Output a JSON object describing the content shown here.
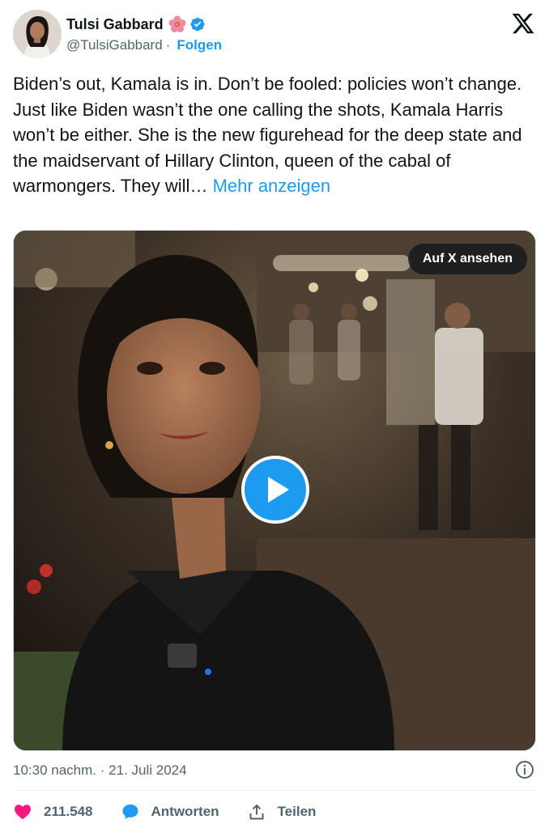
{
  "author": {
    "name": "Tulsi Gabbard",
    "handle": "@TulsiGabbard",
    "separator": "·",
    "follow_label": "Folgen",
    "emoji_icon": "hibiscus-icon",
    "verified_icon": "verified-badge-icon"
  },
  "tweet": {
    "text": "Biden’s out, Kamala is in. Don’t be fooled: policies won’t change.  Just like Biden wasn’t the one calling the shots, Kamala Harris won’t be either. She is the new figurehead for the deep state and the maidservant of Hillary Clinton, queen of the cabal of warmongers. They will…",
    "more_label": "Mehr anzeigen"
  },
  "media": {
    "watch_on_x_label": "Auf X ansehen",
    "play_icon": "play-icon"
  },
  "meta": {
    "time": "10:30 nachm.",
    "separator": "·",
    "date": "21. Juli 2024"
  },
  "actions": {
    "likes": "211.548",
    "reply_label": "Antworten",
    "share_label": "Teilen"
  },
  "colors": {
    "accent": "#1d9bf0",
    "like": "#f91880",
    "text": "#0f1419",
    "secondary": "#536471"
  }
}
